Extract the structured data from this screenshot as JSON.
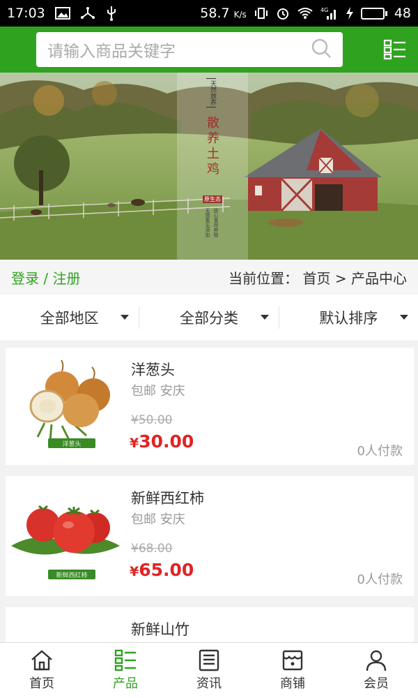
{
  "status_bar": {
    "time": "17:03",
    "speed": "58.7",
    "speed_unit": "K/s",
    "network": "4G",
    "battery": "48"
  },
  "search": {
    "placeholder": "请输入商品关键字"
  },
  "banner": {
    "tag_top": "天然放养",
    "title": "散养土鸡",
    "badge": "原生态",
    "side_text_1": "无激素无添加",
    "side_text_2": "放心食用养殖"
  },
  "breadcrumb": {
    "login": "登录",
    "separator": "/",
    "register": "注册",
    "position_prefix": "当前位置：",
    "home": "首页",
    "arrow": ">",
    "current": "产品中心"
  },
  "filters": [
    {
      "label": "全部地区"
    },
    {
      "label": "全部分类"
    },
    {
      "label": "默认排序"
    }
  ],
  "products": [
    {
      "name": "洋葱头",
      "meta": "包邮 安庆",
      "old_price": "¥50.00",
      "currency": "¥",
      "price": "30.00",
      "paid": "0人付款",
      "image_label": "洋葱头"
    },
    {
      "name": "新鲜西红柿",
      "meta": "包邮 安庆",
      "old_price": "¥68.00",
      "currency": "¥",
      "price": "65.00",
      "paid": "0人付款",
      "image_label": "新鲜西红柿"
    },
    {
      "name": "新鲜山竹"
    }
  ],
  "tabbar": [
    {
      "label": "首页",
      "icon": "home-icon"
    },
    {
      "label": "产品",
      "icon": "product-list-icon",
      "active": true
    },
    {
      "label": "资讯",
      "icon": "news-icon"
    },
    {
      "label": "商铺",
      "icon": "shop-icon"
    },
    {
      "label": "会员",
      "icon": "user-icon"
    }
  ],
  "colors": {
    "brand_green": "#2fa31f",
    "price_red": "#e02424"
  }
}
